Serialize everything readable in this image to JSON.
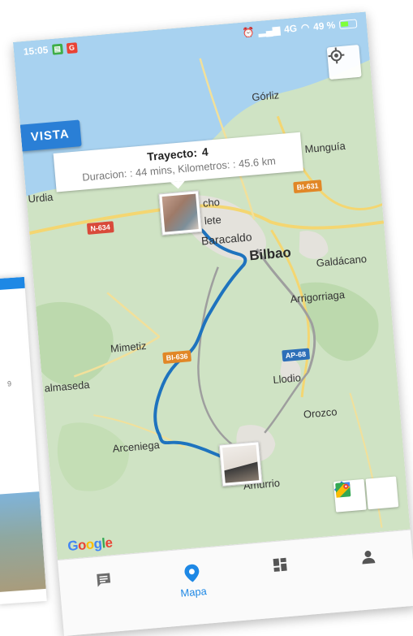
{
  "status_bar": {
    "time": "15:05",
    "battery": "49 %",
    "network": "4G"
  },
  "map": {
    "vista_button": "VISTA",
    "info": {
      "title_label": "Trayecto:",
      "title_value": "4",
      "details": "Duracion: : 44 mins, Kilometros: : 45.6 km"
    },
    "places": {
      "gorliz": "Górliz",
      "mungia": "Munguía",
      "urdiales": "Urdia",
      "santurtzi_partial": "cho",
      "sestao_partial": "lete",
      "baracaldo": "Baracaldo",
      "bilbao": "Bilbao",
      "galdacano": "Galdácano",
      "arrigorriaga": "Arrigorriaga",
      "mimetiz": "Mimetiz",
      "balmaseda": "almaseda",
      "llodio": "Llodio",
      "orozco": "Orozco",
      "arceniega": "Arceniega",
      "amurrio": "Amurrio"
    },
    "roads": {
      "n634": "N-634",
      "bi631": "BI-631",
      "bi636": "BI-636",
      "ap68": "AP-68"
    },
    "google_logo": [
      "G",
      "o",
      "o",
      "g",
      "l",
      "e"
    ],
    "colors": {
      "route": "#1e73be",
      "accent": "#1e88e5",
      "water": "#a8d2f0",
      "land": "#cfe3c4",
      "city": "#e4e2dc"
    }
  },
  "bottom_nav": {
    "items": [
      {
        "icon": "chat-icon",
        "label": ""
      },
      {
        "icon": "location-pin-icon",
        "label": "Mapa"
      },
      {
        "icon": "dashboard-icon",
        "label": ""
      },
      {
        "icon": "person-icon",
        "label": ""
      }
    ]
  },
  "background_card": {
    "digit": "9"
  }
}
